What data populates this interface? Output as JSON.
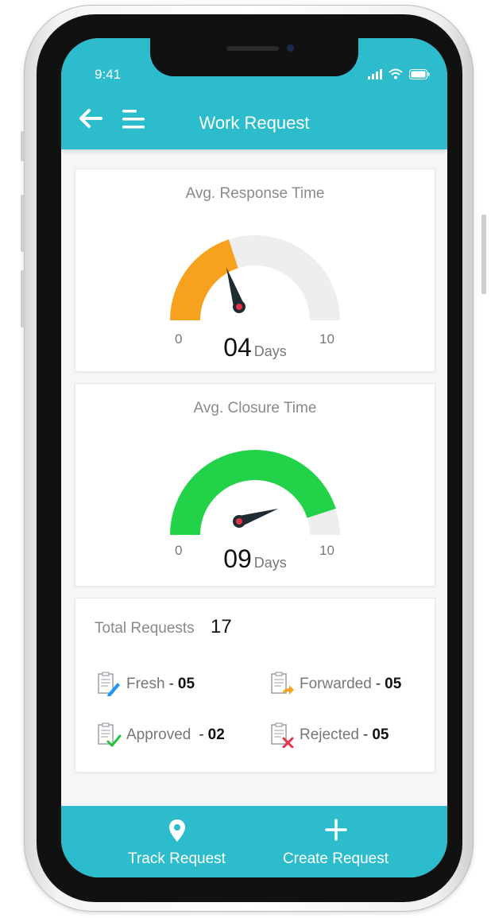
{
  "status_bar": {
    "time": "9:41"
  },
  "header": {
    "title": "Work Request"
  },
  "response_gauge": {
    "title": "Avg. Response Time",
    "min": "0",
    "max": "10",
    "value": 4,
    "value_text": "04",
    "unit": "Days",
    "fill_color": "#f7a21e"
  },
  "closure_gauge": {
    "title": "Avg. Closure Time",
    "min": "0",
    "max": "10",
    "value": 9,
    "value_text": "09",
    "unit": "Days",
    "fill_color": "#22d34a"
  },
  "totals": {
    "label": "Total Requests",
    "count": "17",
    "items": [
      {
        "label": "Fresh",
        "separator": "-",
        "count": "05",
        "icon": "fresh-doc-icon"
      },
      {
        "label": "Forwarded",
        "separator": "-",
        "count": "05",
        "icon": "forwarded-doc-icon"
      },
      {
        "label": "Approved",
        "separator": "-",
        "count": "02",
        "icon": "approved-doc-icon"
      },
      {
        "label": "Rejected",
        "separator": "-",
        "count": "05",
        "icon": "rejected-doc-icon"
      }
    ]
  },
  "bottom_nav": {
    "track_label": "Track Request",
    "create_label": "Create Request"
  },
  "colors": {
    "accent": "#2cbccb",
    "track": "#eeeeee",
    "needle": "#1f2d33",
    "needle_dot": "#e8324a"
  }
}
